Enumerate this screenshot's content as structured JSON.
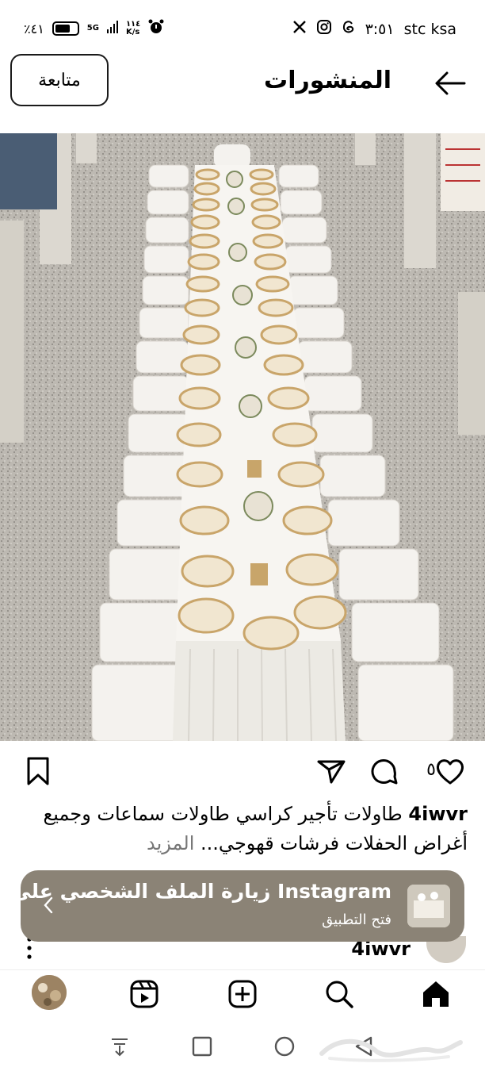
{
  "status_bar": {
    "battery": "٪٤١",
    "speed_value": "١١٤",
    "speed_unit": "K/s",
    "network": "5G",
    "time": "٣:٥١",
    "carrier": "stc ksa"
  },
  "header": {
    "title": "المنشورات",
    "follow_label": "متابعة"
  },
  "post": {
    "like_count": "٥",
    "caption_user": "4iwvr",
    "caption_text": " طاولات تأجير كراسي طاولات سماعات وجميع أغراض الحفلات فرشات قهوجي...",
    "more_label": " المزيد"
  },
  "banner": {
    "title": "زيارة الملف الشخصي على Instagram",
    "subtitle": "فتح التطبيق"
  },
  "comment": {
    "user": "4iwvr"
  },
  "icons": {
    "back": "arrow-left-icon",
    "like": "heart-icon",
    "comment": "comment-icon",
    "share": "send-icon",
    "save": "bookmark-icon",
    "home": "home-icon",
    "search": "search-icon",
    "create": "plus-square-icon",
    "reels": "reels-icon"
  },
  "colors": {
    "banner_bg": "#8b8376",
    "text": "#000000",
    "more": "#777777"
  }
}
